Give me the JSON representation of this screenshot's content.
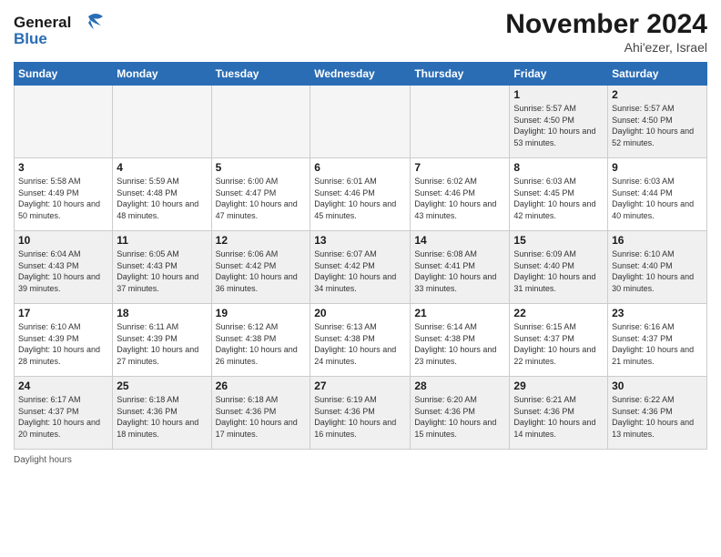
{
  "logo": {
    "line1": "General",
    "line2": "Blue"
  },
  "title": "November 2024",
  "location": "Ahi'ezer, Israel",
  "days_header": [
    "Sunday",
    "Monday",
    "Tuesday",
    "Wednesday",
    "Thursday",
    "Friday",
    "Saturday"
  ],
  "footer_text": "Daylight hours",
  "weeks": [
    [
      {
        "day": "",
        "info": ""
      },
      {
        "day": "",
        "info": ""
      },
      {
        "day": "",
        "info": ""
      },
      {
        "day": "",
        "info": ""
      },
      {
        "day": "",
        "info": ""
      },
      {
        "day": "1",
        "info": "Sunrise: 5:57 AM\nSunset: 4:50 PM\nDaylight: 10 hours\nand 53 minutes."
      },
      {
        "day": "2",
        "info": "Sunrise: 5:57 AM\nSunset: 4:50 PM\nDaylight: 10 hours\nand 52 minutes."
      }
    ],
    [
      {
        "day": "3",
        "info": "Sunrise: 5:58 AM\nSunset: 4:49 PM\nDaylight: 10 hours\nand 50 minutes."
      },
      {
        "day": "4",
        "info": "Sunrise: 5:59 AM\nSunset: 4:48 PM\nDaylight: 10 hours\nand 48 minutes."
      },
      {
        "day": "5",
        "info": "Sunrise: 6:00 AM\nSunset: 4:47 PM\nDaylight: 10 hours\nand 47 minutes."
      },
      {
        "day": "6",
        "info": "Sunrise: 6:01 AM\nSunset: 4:46 PM\nDaylight: 10 hours\nand 45 minutes."
      },
      {
        "day": "7",
        "info": "Sunrise: 6:02 AM\nSunset: 4:46 PM\nDaylight: 10 hours\nand 43 minutes."
      },
      {
        "day": "8",
        "info": "Sunrise: 6:03 AM\nSunset: 4:45 PM\nDaylight: 10 hours\nand 42 minutes."
      },
      {
        "day": "9",
        "info": "Sunrise: 6:03 AM\nSunset: 4:44 PM\nDaylight: 10 hours\nand 40 minutes."
      }
    ],
    [
      {
        "day": "10",
        "info": "Sunrise: 6:04 AM\nSunset: 4:43 PM\nDaylight: 10 hours\nand 39 minutes."
      },
      {
        "day": "11",
        "info": "Sunrise: 6:05 AM\nSunset: 4:43 PM\nDaylight: 10 hours\nand 37 minutes."
      },
      {
        "day": "12",
        "info": "Sunrise: 6:06 AM\nSunset: 4:42 PM\nDaylight: 10 hours\nand 36 minutes."
      },
      {
        "day": "13",
        "info": "Sunrise: 6:07 AM\nSunset: 4:42 PM\nDaylight: 10 hours\nand 34 minutes."
      },
      {
        "day": "14",
        "info": "Sunrise: 6:08 AM\nSunset: 4:41 PM\nDaylight: 10 hours\nand 33 minutes."
      },
      {
        "day": "15",
        "info": "Sunrise: 6:09 AM\nSunset: 4:40 PM\nDaylight: 10 hours\nand 31 minutes."
      },
      {
        "day": "16",
        "info": "Sunrise: 6:10 AM\nSunset: 4:40 PM\nDaylight: 10 hours\nand 30 minutes."
      }
    ],
    [
      {
        "day": "17",
        "info": "Sunrise: 6:10 AM\nSunset: 4:39 PM\nDaylight: 10 hours\nand 28 minutes."
      },
      {
        "day": "18",
        "info": "Sunrise: 6:11 AM\nSunset: 4:39 PM\nDaylight: 10 hours\nand 27 minutes."
      },
      {
        "day": "19",
        "info": "Sunrise: 6:12 AM\nSunset: 4:38 PM\nDaylight: 10 hours\nand 26 minutes."
      },
      {
        "day": "20",
        "info": "Sunrise: 6:13 AM\nSunset: 4:38 PM\nDaylight: 10 hours\nand 24 minutes."
      },
      {
        "day": "21",
        "info": "Sunrise: 6:14 AM\nSunset: 4:38 PM\nDaylight: 10 hours\nand 23 minutes."
      },
      {
        "day": "22",
        "info": "Sunrise: 6:15 AM\nSunset: 4:37 PM\nDaylight: 10 hours\nand 22 minutes."
      },
      {
        "day": "23",
        "info": "Sunrise: 6:16 AM\nSunset: 4:37 PM\nDaylight: 10 hours\nand 21 minutes."
      }
    ],
    [
      {
        "day": "24",
        "info": "Sunrise: 6:17 AM\nSunset: 4:37 PM\nDaylight: 10 hours\nand 20 minutes."
      },
      {
        "day": "25",
        "info": "Sunrise: 6:18 AM\nSunset: 4:36 PM\nDaylight: 10 hours\nand 18 minutes."
      },
      {
        "day": "26",
        "info": "Sunrise: 6:18 AM\nSunset: 4:36 PM\nDaylight: 10 hours\nand 17 minutes."
      },
      {
        "day": "27",
        "info": "Sunrise: 6:19 AM\nSunset: 4:36 PM\nDaylight: 10 hours\nand 16 minutes."
      },
      {
        "day": "28",
        "info": "Sunrise: 6:20 AM\nSunset: 4:36 PM\nDaylight: 10 hours\nand 15 minutes."
      },
      {
        "day": "29",
        "info": "Sunrise: 6:21 AM\nSunset: 4:36 PM\nDaylight: 10 hours\nand 14 minutes."
      },
      {
        "day": "30",
        "info": "Sunrise: 6:22 AM\nSunset: 4:36 PM\nDaylight: 10 hours\nand 13 minutes."
      }
    ]
  ]
}
